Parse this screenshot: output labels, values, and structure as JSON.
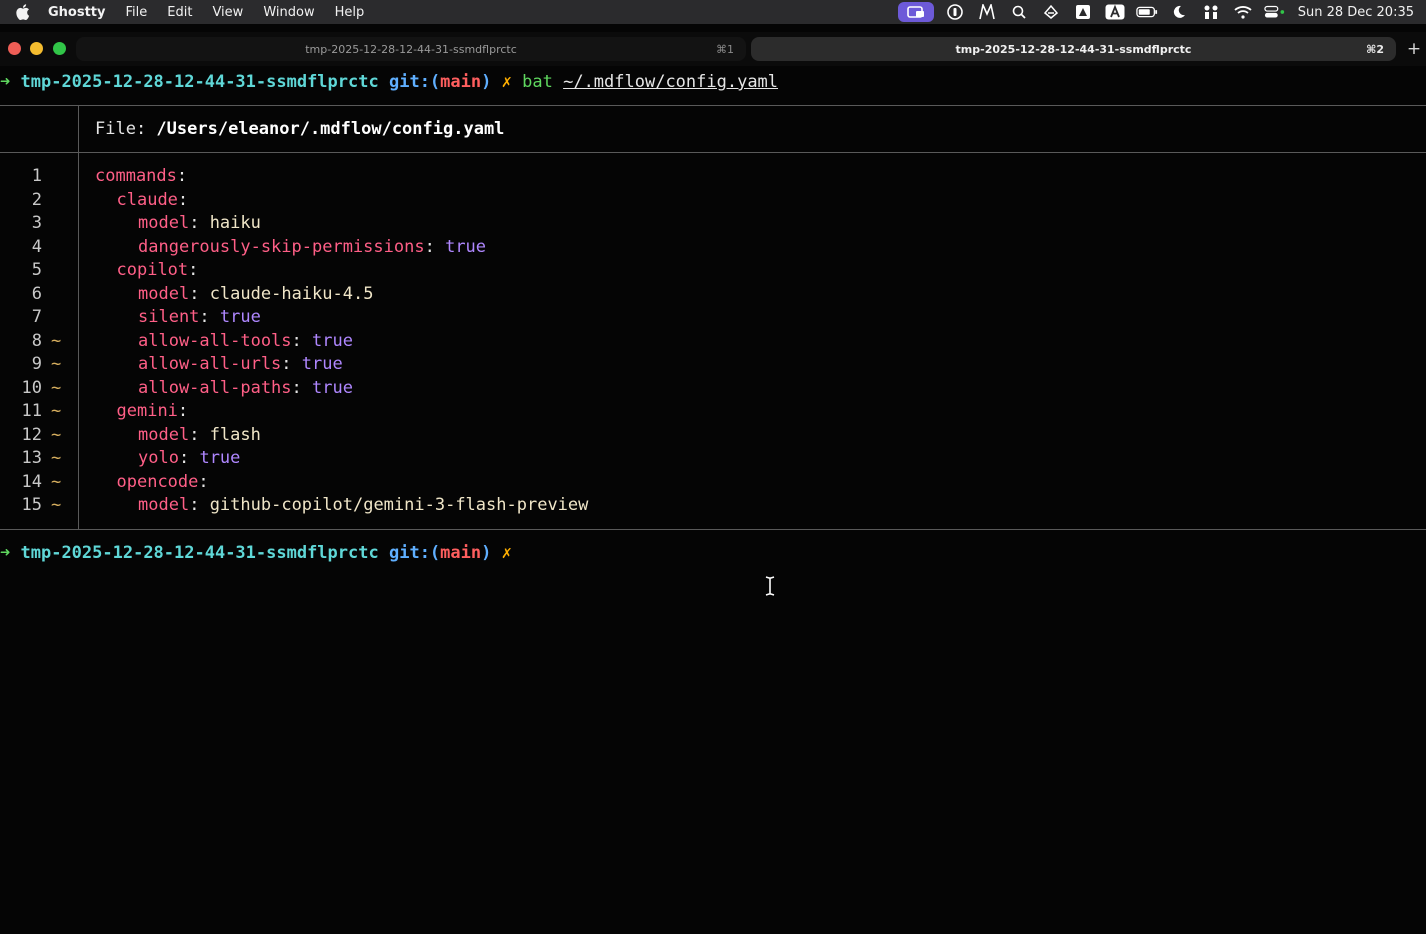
{
  "menubar": {
    "app_name": "Ghostty",
    "items": [
      "File",
      "Edit",
      "View",
      "Window",
      "Help"
    ],
    "clock": "Sun 28 Dec  20:35"
  },
  "tabs": [
    {
      "title": "tmp-2025-12-28-12-44-31-ssmdflprctc",
      "shortcut": "⌘1",
      "active": false
    },
    {
      "title": "tmp-2025-12-28-12-44-31-ssmdflprctc",
      "shortcut": "⌘2",
      "active": true
    }
  ],
  "new_tab_label": "+",
  "prompt": {
    "arrow": "➜",
    "dir": "tmp-2025-12-28-12-44-31-ssmdflprctc",
    "git_label": "git:(",
    "branch": "main",
    "git_close": ")",
    "dirty": "✗"
  },
  "command": {
    "name": "bat",
    "arg": "~/.mdflow/config.yaml"
  },
  "file_header": {
    "label": "File: ",
    "path": "/Users/eleanor/.mdflow/config.yaml"
  },
  "code_lines": [
    {
      "n": "1",
      "mark": "",
      "indent": 0,
      "key": "commands",
      "value": "",
      "type": "none"
    },
    {
      "n": "2",
      "mark": "",
      "indent": 1,
      "key": "claude",
      "value": "",
      "type": "none"
    },
    {
      "n": "3",
      "mark": "",
      "indent": 2,
      "key": "model",
      "value": "haiku",
      "type": "str"
    },
    {
      "n": "4",
      "mark": "",
      "indent": 2,
      "key": "dangerously-skip-permissions",
      "value": "true",
      "type": "bool"
    },
    {
      "n": "5",
      "mark": "",
      "indent": 1,
      "key": "copilot",
      "value": "",
      "type": "none"
    },
    {
      "n": "6",
      "mark": "",
      "indent": 2,
      "key": "model",
      "value": "claude-haiku-4.5",
      "type": "str"
    },
    {
      "n": "7",
      "mark": "",
      "indent": 2,
      "key": "silent",
      "value": "true",
      "type": "bool"
    },
    {
      "n": "8",
      "mark": "~",
      "indent": 2,
      "key": "allow-all-tools",
      "value": "true",
      "type": "bool"
    },
    {
      "n": "9",
      "mark": "~",
      "indent": 2,
      "key": "allow-all-urls",
      "value": "true",
      "type": "bool"
    },
    {
      "n": "10",
      "mark": "~",
      "indent": 2,
      "key": "allow-all-paths",
      "value": "true",
      "type": "bool"
    },
    {
      "n": "11",
      "mark": "~",
      "indent": 1,
      "key": "gemini",
      "value": "",
      "type": "none"
    },
    {
      "n": "12",
      "mark": "~",
      "indent": 2,
      "key": "model",
      "value": "flash",
      "type": "str"
    },
    {
      "n": "13",
      "mark": "~",
      "indent": 2,
      "key": "yolo",
      "value": "true",
      "type": "bool"
    },
    {
      "n": "14",
      "mark": "~",
      "indent": 1,
      "key": "opencode",
      "value": "",
      "type": "none"
    },
    {
      "n": "15",
      "mark": "~",
      "indent": 2,
      "key": "model",
      "value": "github-copilot/gemini-3-flash-preview",
      "type": "str"
    }
  ],
  "colors": {
    "background": "#050505",
    "key": "#ff5f87",
    "string": "#f0e6c8",
    "bool": "#af87ff",
    "prompt_arrow": "#5fd75f",
    "prompt_dir": "#5fd7d7",
    "git": "#5fafff",
    "branch": "#ff5f5f"
  },
  "icons": [
    "apple-icon",
    "screen-mirroring-icon",
    "password-icon",
    "m-app-icon",
    "spotlight-search-icon",
    "bird-icon",
    "drive-icon",
    "text-input-a-icon",
    "battery-icon",
    "moon-icon",
    "people-icon",
    "wifi-icon",
    "control-center-icon"
  ]
}
